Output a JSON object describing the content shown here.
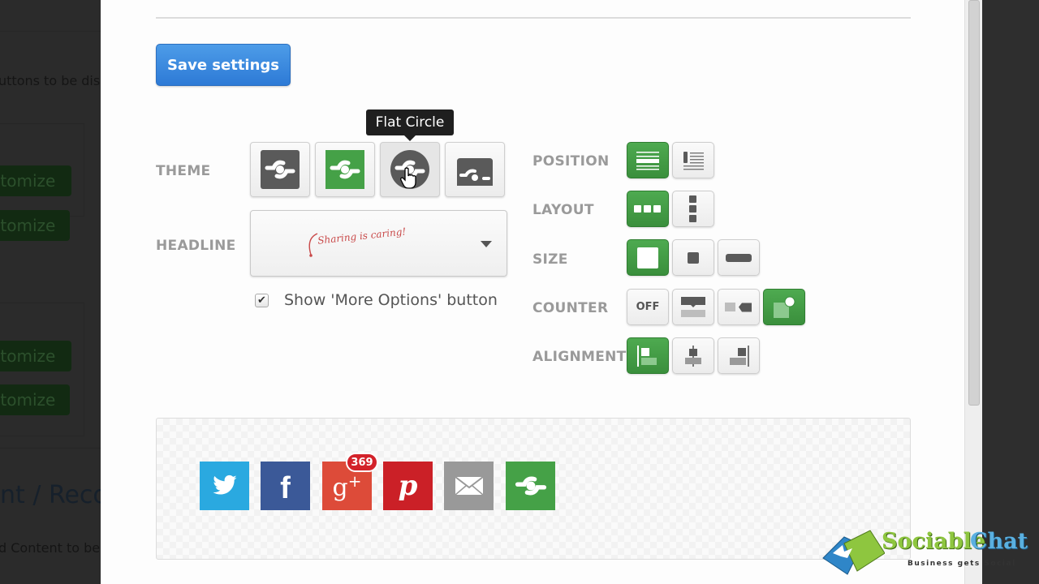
{
  "background_page": {
    "description_fragment": "uttons to be dis",
    "customize_buttons": [
      "stomize",
      "stomize",
      "stomize",
      "stomize"
    ],
    "section_heading_fragment": "nt / Recor",
    "section_text_fragment": "d Content to be"
  },
  "toolbar": {
    "save_label": "Save settings"
  },
  "theme": {
    "label": "THEME",
    "tooltip": "Flat Circle",
    "options": [
      {
        "name": "Flat",
        "icon": "theme-flat-dark-icon"
      },
      {
        "name": "Flat Green",
        "icon": "theme-flat-green-icon"
      },
      {
        "name": "Flat Circle",
        "icon": "theme-flat-circle-icon",
        "hovered": true
      },
      {
        "name": "Tab",
        "icon": "theme-tab-icon"
      }
    ]
  },
  "headline": {
    "label": "HEADLINE",
    "selected_value": "Sharing is caring!"
  },
  "more_options": {
    "label": "Show 'More Options' button",
    "checked": true
  },
  "position": {
    "label": "POSITION",
    "options": [
      "Inline",
      "Floating side"
    ],
    "selected_index": 0
  },
  "layout": {
    "label": "LAYOUT",
    "options": [
      "Horizontal",
      "Vertical"
    ],
    "selected_index": 0
  },
  "size": {
    "label": "SIZE",
    "options": [
      "Large",
      "Small",
      "Wide"
    ],
    "selected_index": 0
  },
  "counter": {
    "label": "COUNTER",
    "off_label": "OFF",
    "options": [
      "Off",
      "Top",
      "Side",
      "Bubble"
    ],
    "selected_index": 3
  },
  "alignment": {
    "label": "ALIGNMENT",
    "options": [
      "Left",
      "Center",
      "Right"
    ],
    "selected_index": 0
  },
  "preview": {
    "buttons": [
      {
        "network": "twitter",
        "color": "#2aa9e0",
        "icon": "twitter-icon"
      },
      {
        "network": "facebook",
        "color": "#3b5998",
        "icon": "facebook-icon"
      },
      {
        "network": "google-plus",
        "color": "#dd4b39",
        "icon": "google-plus-icon",
        "count": "369"
      },
      {
        "network": "pinterest",
        "color": "#cb2027",
        "icon": "pinterest-icon"
      },
      {
        "network": "email",
        "color": "#999999",
        "icon": "email-icon"
      },
      {
        "network": "more",
        "color": "#45a147",
        "icon": "share-more-icon"
      }
    ]
  },
  "watermark": {
    "brand_part1": "Sociable",
    "brand_part2": "Chat",
    "tagline": "Business gets Social"
  },
  "colors": {
    "accent_green": "#45a147",
    "save_blue": "#3a88dd",
    "gray_icon": "#5a5a5a"
  }
}
